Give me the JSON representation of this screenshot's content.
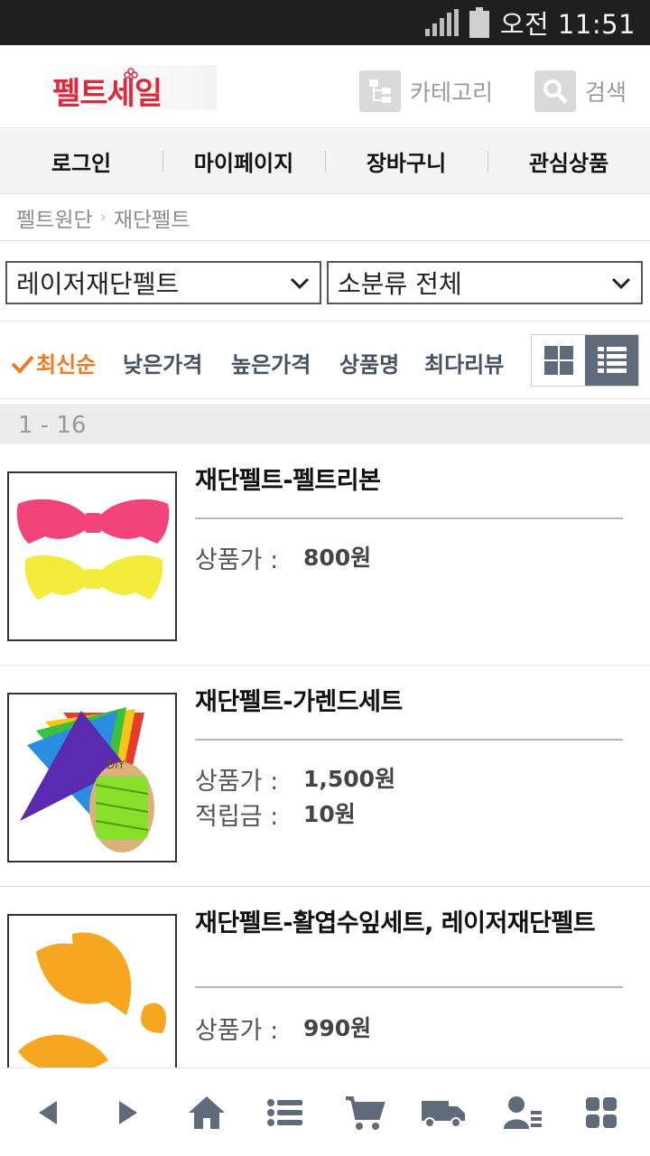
{
  "status_bar": {
    "time": "오전 11:51"
  },
  "header": {
    "logo_text": "펠트세일",
    "category_label": "카테고리",
    "search_label": "검색"
  },
  "top_nav": [
    "로그인",
    "마이페이지",
    "장바구니",
    "관심상품"
  ],
  "breadcrumb": [
    "펠트원단",
    "재단펠트"
  ],
  "filters": {
    "category_value": "레이저재단펠트",
    "subcategory_value": "소분류 전체"
  },
  "sort": {
    "options": [
      "최신순",
      "낮은가격",
      "높은가격",
      "상품명",
      "최다리뷰"
    ],
    "active": "최신순"
  },
  "count_text": "1 - 16",
  "products": [
    {
      "name": "재단펠트-펠트리본",
      "price_label": "상품가 :",
      "price": "800원"
    },
    {
      "name": "재단펠트-가렌드세트",
      "price_label": "상품가 :",
      "price": "1,500원",
      "points_label": "적립금 :",
      "points": "10원"
    },
    {
      "name": "재단펠트-활엽수잎세트, 레이저재단펠트",
      "price_label": "상품가 :",
      "price": "990원"
    }
  ],
  "thumb_texts": {
    "diy": "DIY"
  },
  "colors": {
    "brand": "#e0283c",
    "active_sort": "#f07a1d",
    "nav_dark": "#455266"
  },
  "bottom_nav_icons": [
    "back-icon",
    "forward-icon",
    "home-icon",
    "list-icon",
    "cart-icon",
    "delivery-truck-icon",
    "user-list-icon",
    "grid-menu-icon"
  ]
}
